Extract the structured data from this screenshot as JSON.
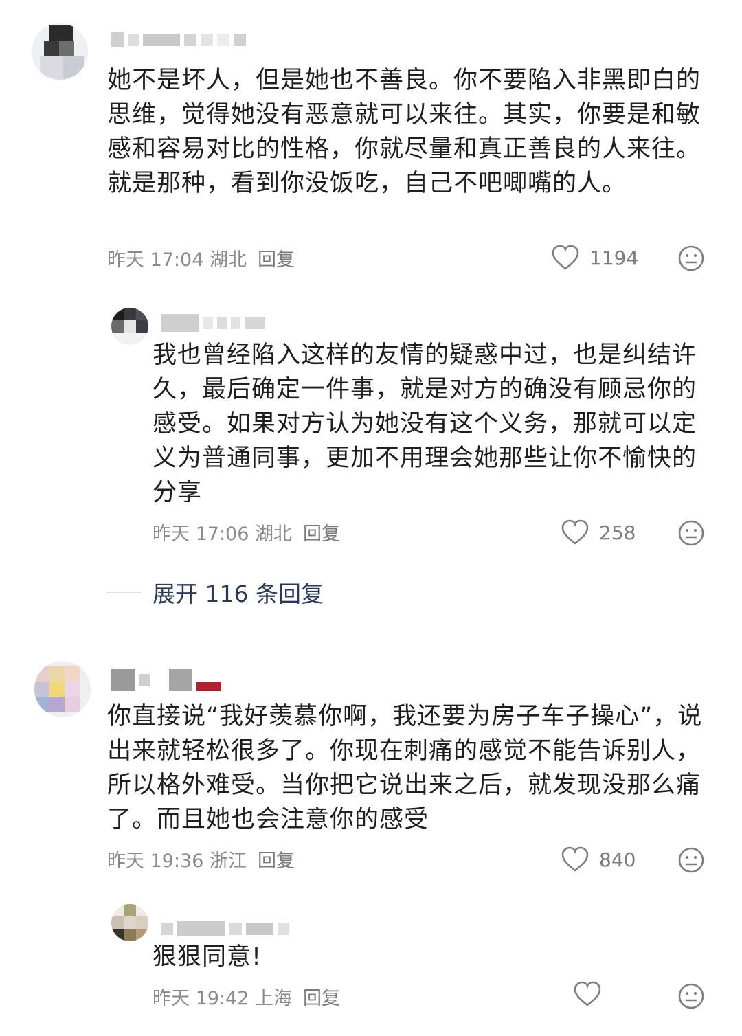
{
  "comments": [
    {
      "text": "她不是坏人，但是她也不善良。你不要陷入非黑即白的思维，觉得她没有恶意就可以来往。其实，你要是和敏感和容易对比的性格，你就尽量和真正善良的人来往。就是那种，看到你没饭吃，自己不吧唧嘴的人。",
      "time": "昨天 17:04",
      "location": "湖北",
      "reply_label": "回复",
      "likes": "1194",
      "replies": [
        {
          "text": "我也曾经陷入这样的友情的疑惑中过，也是纠结许久，最后确定一件事，就是对方的确没有顾忌你的感受。如果对方认为她没有这个义务，那就可以定义为普通同事，更加不用理会她那些让你不愉快的分享",
          "time": "昨天 17:06",
          "location": "湖北",
          "reply_label": "回复",
          "likes": "258"
        }
      ],
      "expand_label": "展开 116 条回复"
    },
    {
      "text": "你直接说“我好羡慕你啊，我还要为房子车子操心”，说出来就轻松很多了。你现在刺痛的感觉不能告诉别人，所以格外难受。当你把它说出来之后，就发现没那么痛了。而且她也会注意你的感受",
      "time": "昨天 19:36",
      "location": "浙江",
      "reply_label": "回复",
      "likes": "840",
      "replies": [
        {
          "text": "狠狠同意!",
          "time": "昨天 19:42",
          "location": "上海",
          "reply_label": "回复"
        }
      ]
    }
  ],
  "icons": {
    "like": "heart-outline-icon",
    "dislike": "neutral-face-icon"
  },
  "colors": {
    "text": "#1f1f1f",
    "meta": "#8a8a8a",
    "expand": "#2a3a5a"
  }
}
